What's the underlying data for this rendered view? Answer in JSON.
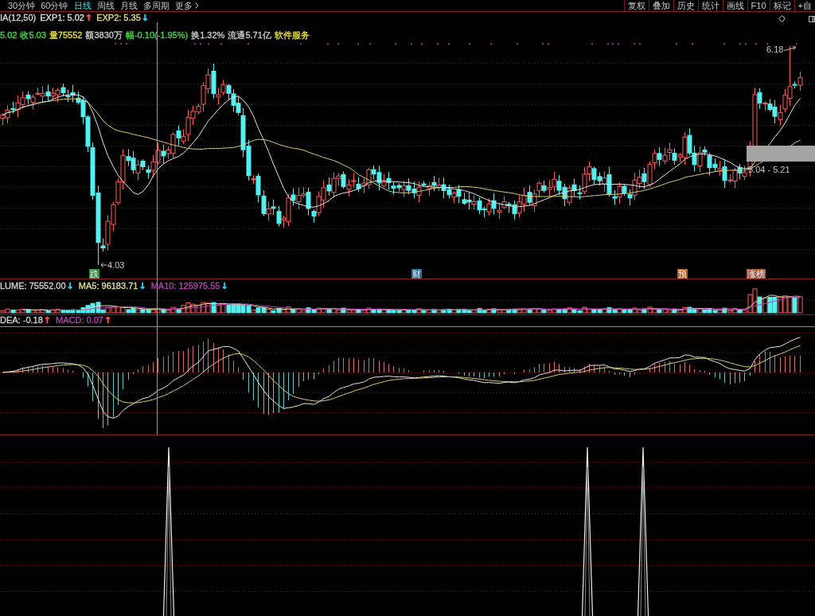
{
  "toolbar": {
    "periods": [
      {
        "label": "30分钟",
        "selected": false
      },
      {
        "label": "60分钟",
        "selected": false
      },
      {
        "label": "日线",
        "selected": true
      },
      {
        "label": "周线",
        "selected": false
      },
      {
        "label": "月线",
        "selected": false
      },
      {
        "label": "多周期",
        "selected": false
      }
    ],
    "more": "更多",
    "tools": [
      "复权",
      "叠加",
      "历史",
      "统计",
      "画线",
      "F10",
      "标记",
      "+自"
    ]
  },
  "indicator": {
    "name": "IA(12,50)",
    "values": [
      {
        "label": "EXP1: 5.02",
        "color": "#e0e0e0",
        "arrow": {
          "text": "↑",
          "color": "#ff4a4a"
        }
      },
      {
        "label": "EXP2: 5.35",
        "color": "#e6e07a",
        "arrow": {
          "text": "↓",
          "color": "#3cc8e8"
        }
      }
    ]
  },
  "quote": [
    {
      "text": "5.02",
      "color": "#3ee03e"
    },
    {
      "text": "收5.03",
      "color": "#3ee03e"
    },
    {
      "text": "量75552",
      "color": "#e8e040"
    },
    {
      "text": "额3830万",
      "color": "#d0d0d0"
    },
    {
      "text": "幅-0.10(-1.95%)",
      "color": "#3ee03e"
    },
    {
      "text": "换1.32%",
      "color": "#d0d0d0"
    },
    {
      "text": "流通5.71亿",
      "color": "#d0d0d0"
    },
    {
      "text": "软件服务",
      "color": "#e8e040"
    }
  ],
  "price_chart": {
    "high_label": "6.18",
    "low_label": "4.03",
    "range_label": "5.04 - 5.21",
    "events": [
      {
        "text": "跌",
        "color": "#2f8f3f"
      },
      {
        "text": "财",
        "color": "#2f6f9f"
      },
      {
        "text": "预",
        "color": "#b8602a"
      },
      {
        "text": "涨榜",
        "color": "#a85a3a"
      }
    ]
  },
  "volume_panel": {
    "legend": [
      {
        "label": "LUME: 75552.00",
        "color": "#d8d8d8",
        "arrow": {
          "text": "↓",
          "color": "#3cc8e8"
        }
      },
      {
        "label": "MA5: 96183.71",
        "color": "#e0e0a0",
        "arrow": {
          "text": "↓",
          "color": "#3cc8e8"
        }
      },
      {
        "label": "MA10: 125975.55",
        "color": "#c040c0",
        "arrow": {
          "text": "↓",
          "color": "#3cc8e8"
        }
      }
    ]
  },
  "macd_panel": {
    "legend": [
      {
        "label": "DEA: -0.18",
        "color": "#d8d8d8",
        "arrow": {
          "text": "↑",
          "color": "#ff4a4a"
        }
      },
      {
        "label": "MACD: 0.07",
        "color": "#c040c0",
        "arrow": {
          "text": "↑",
          "color": "#ff4a4a"
        }
      }
    ]
  }
}
